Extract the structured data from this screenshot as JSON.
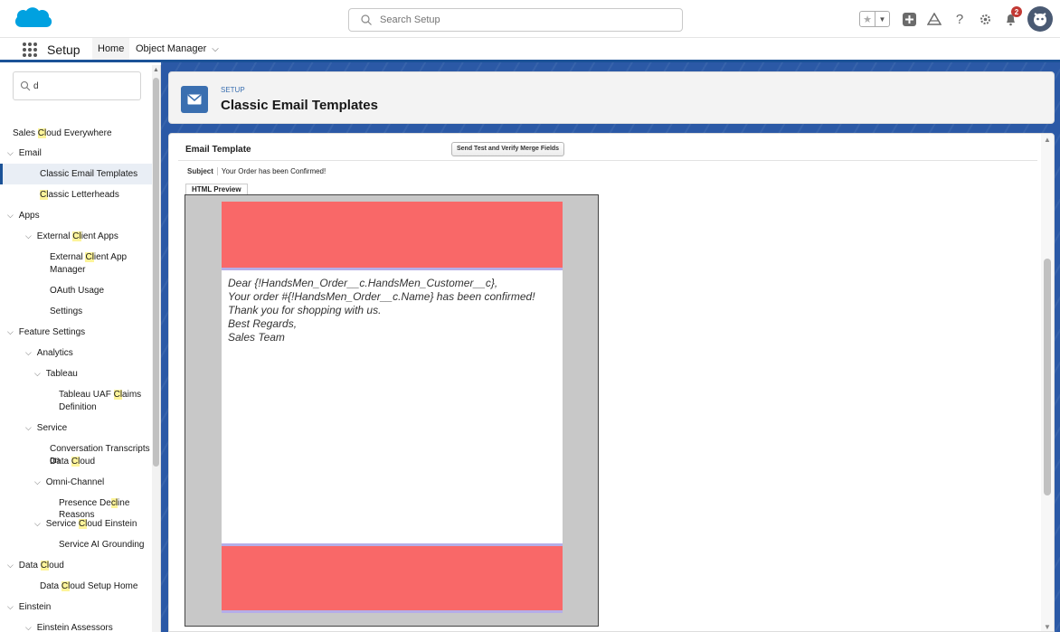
{
  "header": {
    "search_placeholder": "Search Setup",
    "notification_count": "2",
    "icons": [
      "favorites-star-icon",
      "favorites-dropdown-icon",
      "global-add-icon",
      "trailhead-icon",
      "help-icon",
      "gear-icon",
      "bell-icon",
      "avatar"
    ]
  },
  "context_bar": {
    "app_name": "Setup",
    "tabs": [
      {
        "label": "Home"
      },
      {
        "label": "Object Manager"
      }
    ]
  },
  "sidebar": {
    "quick_find_value": "d",
    "items": [
      {
        "pre": "Sales ",
        "hl": "Cl",
        "post": "oud Everywhere"
      },
      {
        "pre": "Email",
        "hl": "",
        "post": ""
      },
      {
        "pre": "Classic Email Templates",
        "hl": "",
        "post": ""
      },
      {
        "pre": "",
        "hl": "Cl",
        "post": "assic Letterheads"
      },
      {
        "pre": "Apps",
        "hl": "",
        "post": ""
      },
      {
        "pre": "External ",
        "hl": "Cl",
        "post": "ient Apps"
      },
      {
        "pre": "External ",
        "hl": "Cl",
        "post": "ient App"
      },
      {
        "pre": "Manager",
        "hl": "",
        "post": ""
      },
      {
        "pre": "OAuth Usage",
        "hl": "",
        "post": ""
      },
      {
        "pre": "Settings",
        "hl": "",
        "post": ""
      },
      {
        "pre": "Feature Settings",
        "hl": "",
        "post": ""
      },
      {
        "pre": "Analytics",
        "hl": "",
        "post": ""
      },
      {
        "pre": "Tableau",
        "hl": "",
        "post": ""
      },
      {
        "pre": "Tableau UAF ",
        "hl": "Cl",
        "post": "aims"
      },
      {
        "pre": "Definition",
        "hl": "",
        "post": ""
      },
      {
        "pre": "Service",
        "hl": "",
        "post": ""
      },
      {
        "pre": "Conversation Transcripts on",
        "hl": "",
        "post": ""
      },
      {
        "pre": "Data ",
        "hl": "Cl",
        "post": "oud"
      },
      {
        "pre": "Omni-Channel",
        "hl": "",
        "post": ""
      },
      {
        "pre": "Presence De",
        "hl": "cl",
        "post": "ine Reasons"
      },
      {
        "pre": "Service ",
        "hl": "Cl",
        "post": "oud Einstein"
      },
      {
        "pre": "Service AI Grounding",
        "hl": "",
        "post": ""
      },
      {
        "pre": "Data ",
        "hl": "Cl",
        "post": "oud"
      },
      {
        "pre": "Data ",
        "hl": "Cl",
        "post": "oud Setup Home"
      },
      {
        "pre": "Einstein",
        "hl": "",
        "post": ""
      },
      {
        "pre": "Einstein Assessors",
        "hl": "",
        "post": ""
      }
    ]
  },
  "page_header": {
    "eyebrow": "SETUP",
    "title": "Classic Email Templates"
  },
  "email_template": {
    "section_title": "Email Template",
    "send_test_button": "Send Test and Verify Merge Fields",
    "subject_label": "Subject",
    "subject_value": "Your Order has been Confirmed!",
    "preview_tab": "HTML Preview",
    "body_lines": [
      "Dear {!HandsMen_Order__c.HandsMen_Customer__c},",
      "Your order #{!HandsMen_Order__c.Name} has been confirmed!",
      "Thank you for shopping with us.",
      "Best Regards,",
      "Sales Team"
    ],
    "letterhead_color": "#f96868",
    "rule_color": "#b5aee8"
  },
  "colors": {
    "brand_blue": "#1b5297",
    "salesforce_cloud": "#00a1e0",
    "highlight": "#fdf49a"
  }
}
